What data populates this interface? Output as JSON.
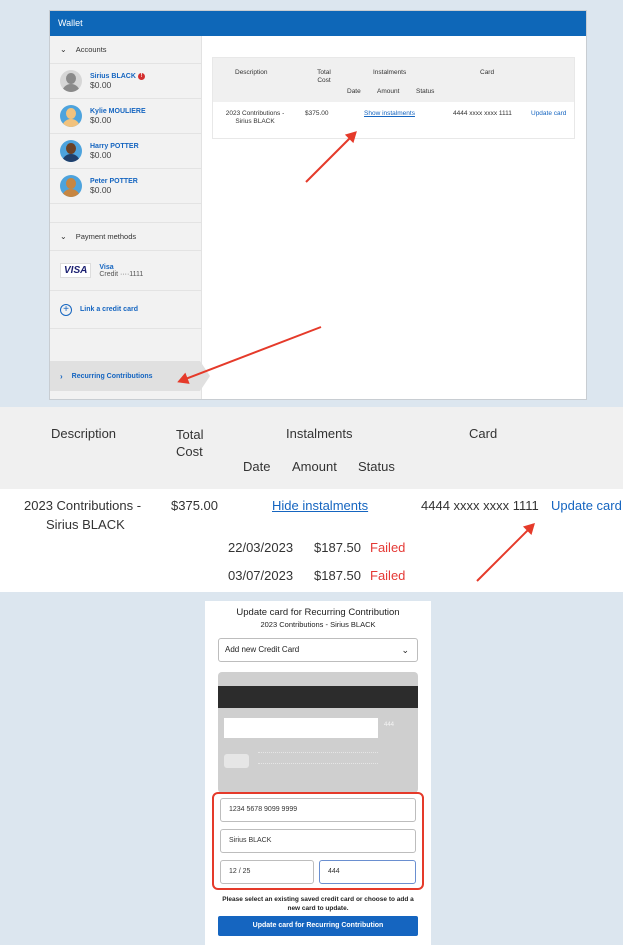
{
  "wallet": {
    "title": "Wallet",
    "accounts_header": "Accounts",
    "accounts": [
      {
        "name": "Sirius BLACK",
        "balance": "$0.00",
        "warning": "!"
      },
      {
        "name": "Kylie MOULIERE",
        "balance": "$0.00"
      },
      {
        "name": "Harry POTTER",
        "balance": "$0.00"
      },
      {
        "name": "Peter POTTER",
        "balance": "$0.00"
      }
    ],
    "payment_header": "Payment methods",
    "payment_method": {
      "brand": "VISA",
      "name": "Visa",
      "detail": "Credit ····1111"
    },
    "link_card": "Link a credit card",
    "recurring": "Recurring Contributions",
    "table": {
      "headers": {
        "description": "Description",
        "total_cost": "Total Cost",
        "instalments": "Instalments",
        "card": "Card",
        "date": "Date",
        "amount": "Amount",
        "status": "Status"
      },
      "row": {
        "description": "2023 Contributions - Sirius BLACK",
        "total": "$375.00",
        "toggle": "Show instalments",
        "card": "4444 xxxx xxxx 1111",
        "update": "Update card"
      }
    }
  },
  "instalments_table": {
    "headers": {
      "description": "Description",
      "total_cost": "Total Cost",
      "instalments": "Instalments",
      "card": "Card",
      "date": "Date",
      "amount": "Amount",
      "status": "Status"
    },
    "row": {
      "description_line1": "2023 Contributions -",
      "description_line2": "Sirius BLACK",
      "total": "$375.00",
      "toggle": "Hide instalments",
      "card": "4444 xxxx xxxx 1111",
      "update": "Update card"
    },
    "instalments": [
      {
        "date": "22/03/2023",
        "amount": "$187.50",
        "status": "Failed"
      },
      {
        "date": "03/07/2023",
        "amount": "$187.50",
        "status": "Failed"
      }
    ]
  },
  "dialog": {
    "title": "Update card for Recurring Contribution",
    "subtitle": "2023 Contributions - Sirius BLACK",
    "select_value": "Add new Credit Card",
    "card_cvv_preview": "444",
    "card_number": "1234 5678 9099 9999",
    "card_name": "Sirius BLACK",
    "expiry": "12 / 25",
    "cvv": "444",
    "help_text": "Please select an existing saved credit card or choose to add a new card to update.",
    "submit": "Update card for Recurring Contribution"
  },
  "colors": {
    "brand_blue": "#0e67b8",
    "link_blue": "#1565c0",
    "failed_red": "#e53935",
    "annotation_red": "#e53a2a",
    "background": "#dce6ef"
  },
  "icons": [
    "chevron-down-icon",
    "chevron-right-icon",
    "warning-icon",
    "avatar-icon",
    "visa-logo",
    "plus-circle-icon",
    "caret-down-icon"
  ]
}
